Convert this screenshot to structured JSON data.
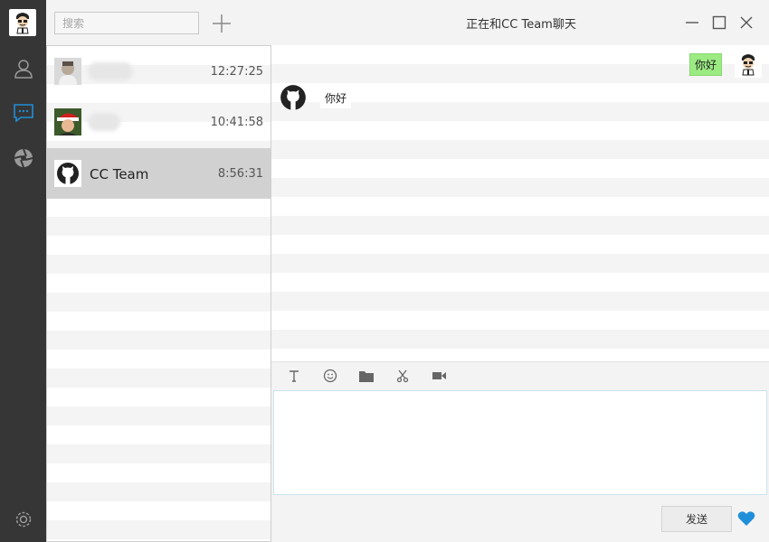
{
  "window": {
    "title": "正在和CC Team聊天"
  },
  "search": {
    "placeholder": "搜索"
  },
  "conversations": [
    {
      "name": "",
      "time": "12:27:25",
      "avatar": "person-photo"
    },
    {
      "name": "",
      "time": "10:41:58",
      "avatar": "santa-hat-photo"
    },
    {
      "name": "CC Team",
      "time": "8:56:31",
      "avatar": "github-logo"
    }
  ],
  "messages": [
    {
      "from": "me",
      "text": "你好"
    },
    {
      "from": "other",
      "text": "你好"
    }
  ],
  "toolbar": {
    "icons": [
      "text-icon",
      "emoji-icon",
      "folder-icon",
      "scissors-icon",
      "video-icon"
    ]
  },
  "composer": {
    "send_label": "发送"
  },
  "colors": {
    "sidebar": "#363636",
    "accent": "#1f8fd9",
    "my_bubble": "#9beb82",
    "selected_row": "#d1d1d1"
  }
}
